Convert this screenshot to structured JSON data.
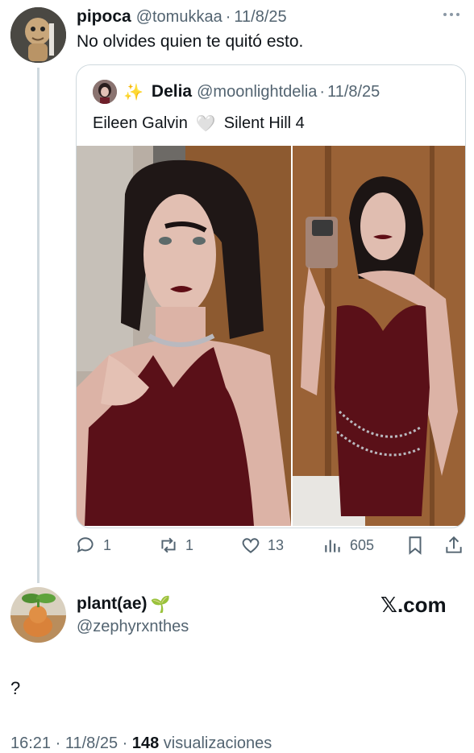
{
  "main_tweet": {
    "display_name": "pipoca",
    "handle": "@tomukkaa",
    "separator": "·",
    "date": "11/8/25",
    "text": "No olvides quien te quitó esto.",
    "more_icon": "more-dots-icon"
  },
  "quoted_tweet": {
    "sparkle": "✨",
    "display_name": "Delia",
    "handle": "@moonlightdelia",
    "separator": "·",
    "date": "11/8/25",
    "text_part1": "Eileen Galvin",
    "heart": "🤍",
    "text_part2": "Silent Hill 4"
  },
  "actions": {
    "replies": "1",
    "retweets": "1",
    "likes": "13",
    "views": "605"
  },
  "reply": {
    "display_name": "plant(ae)",
    "plant_emoji": "🌱",
    "handle": "@zephyrxnthes",
    "text": "?",
    "watermark": "𝕏.com",
    "meta": "16:21 · 11/8/25 · ",
    "views_count": "148",
    "views_label": " visualizaciones"
  }
}
